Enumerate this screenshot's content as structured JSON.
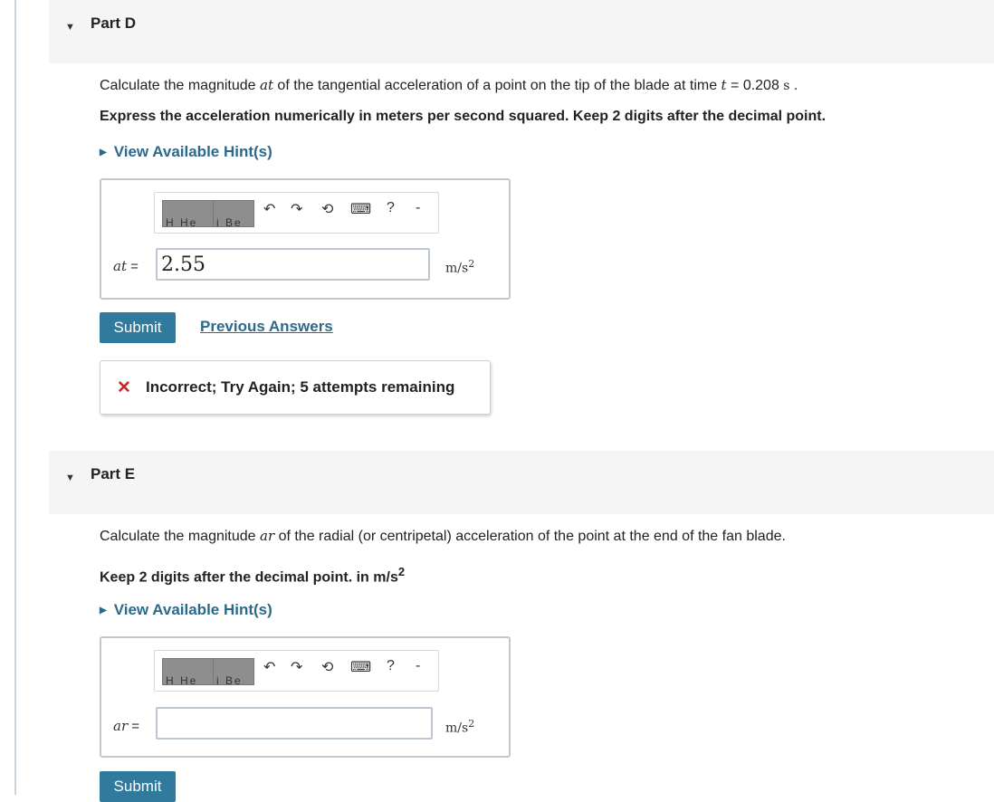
{
  "parts": [
    {
      "toggle_icon": "caret-down-icon",
      "title": "Part D",
      "question": {
        "prefix": "Calculate the magnitude ",
        "var": "at",
        "mid": " of the tangential acceleration of a point on the tip of the blade at time ",
        "time_var": "t",
        "time_value": " = 0.208 ",
        "time_unit": "s",
        "end": " ."
      },
      "instruction": "Express the acceleration numerically in meters per second squared. Keep 2 digits after the decimal point.",
      "hint_label": "View Available Hint(s)",
      "toolbar": {
        "block1_caption": "H  He",
        "block2_caption": "i  Be",
        "undo": "↶",
        "redo": "↷",
        "reset": "⟲",
        "keyboard": "⌨",
        "help": "?"
      },
      "field_label": "at",
      "field_eq": "=",
      "input_value": "2.55",
      "unit_base": "m/s",
      "unit_exp": "2",
      "submit_label": "Submit",
      "previous_answers_label": "Previous Answers",
      "feedback": "Incorrect; Try Again; 5 attempts remaining"
    },
    {
      "toggle_icon": "caret-down-icon",
      "title": "Part E",
      "question": {
        "prefix": "Calculate the magnitude ",
        "var": "ar",
        "end": " of the radial (or centripetal) acceleration of the point at the end of the fan blade."
      },
      "instruction_text": "Keep 2 digits after the decimal point. in m/s",
      "instruction_exp": "2",
      "hint_label": "View Available Hint(s)",
      "toolbar": {
        "block1_caption": "H  He",
        "block2_caption": "i  Be",
        "undo": "↶",
        "redo": "↷",
        "reset": "⟲",
        "keyboard": "⌨",
        "help": "?"
      },
      "field_label": "ar",
      "field_eq": "=",
      "input_value": "",
      "unit_base": "m/s",
      "unit_exp": "2",
      "submit_label": "Submit"
    }
  ],
  "colors": {
    "link": "#2b6a8a",
    "submit_bg": "#2f7a9d",
    "error": "#c62828",
    "header_bg": "#f5f5f5"
  }
}
